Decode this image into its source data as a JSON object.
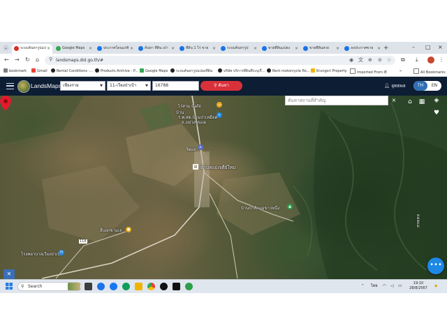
{
  "browser": {
    "tabs": [
      {
        "label": "ระบบค้นหารูปแป",
        "color": "#d93025",
        "active": true
      },
      {
        "label": "Google Maps",
        "color": "#34a853",
        "active": false
      },
      {
        "label": "ประกาศโดนแก่คิ",
        "color": "#1877f2",
        "active": false
      },
      {
        "label": "ค้นหา ที่ดิน เป่า",
        "color": "#1a73e8",
        "active": false
      },
      {
        "label": "ที่ดิน 1 ไร่ ขาย",
        "color": "#1a73e8",
        "active": false
      },
      {
        "label": "ระบบค้นหารูป",
        "color": "#1a73e8",
        "active": false
      },
      {
        "label": "ขายที่ดินแปลง",
        "color": "#1a73e8",
        "active": false
      },
      {
        "label": "ขายที่ดินสวย",
        "color": "#1a73e8",
        "active": false
      },
      {
        "label": "ลงประกาศขาย",
        "color": "#1a73e8",
        "active": false
      }
    ],
    "new_tab": "+",
    "url": "landsmaps.dol.go.th/#",
    "bookmarks": [
      {
        "label": "bookmark",
        "color": "#5f6368"
      },
      {
        "label": "Gmail",
        "color": "#ea4335"
      },
      {
        "label": "Rental Conditions -...",
        "color": "#202124"
      },
      {
        "label": "Products Archive - P...",
        "color": "#202124"
      },
      {
        "label": "Google Maps",
        "color": "#34a853"
      },
      {
        "label": "ระบบค้นหารูปแปลงที่ดิน",
        "color": "#202124"
      },
      {
        "label": "บริษัท บริการที่ดินที่ระบุเรื่...",
        "color": "#202124"
      },
      {
        "label": "Rent motorcycle flo...",
        "color": "#202124"
      },
      {
        "label": "Krungsri Property",
        "color": "#f4b400"
      },
      {
        "label": "Imported From IE",
        "color": "#5f6368"
      }
    ],
    "more_bookmarks": "»",
    "all_bookmarks": "All Bookmarks"
  },
  "app": {
    "brand": "LandsMaps",
    "province": "เชียงราย",
    "district": "11-เวียงป่าเป้า",
    "parcel_number": "16788",
    "search_button": "ค้นหา",
    "user_name": "ยุทธพล",
    "lang_th": "TH",
    "lang_en": "EN"
  },
  "map": {
    "place_search_placeholder": "ค้นหาสถานที่สำคัญ",
    "labels": {
      "cafe": "ไร่สาม Café",
      "school1": "บ้าน",
      "school2": "ร.พ.สต.บ้านป่าเหมือด",
      "school3": "อ.แม่วงพูนแม",
      "temple": "วัดแย",
      "office": "ตำบลแม่เจดีย์ใหม่",
      "village": "บ้านป่าสักแม่ขาวหนึ่ง",
      "junction": "สี่แยกขามเจ",
      "road_sign": "118",
      "hospital": "โรงพยาบาลเวียงป่าเป้า",
      "right_edge": "ดอยแม่"
    }
  },
  "taskbar": {
    "search_label": "Search",
    "lang": "ไทย",
    "time": "19:10",
    "date": "28/8/2567"
  }
}
